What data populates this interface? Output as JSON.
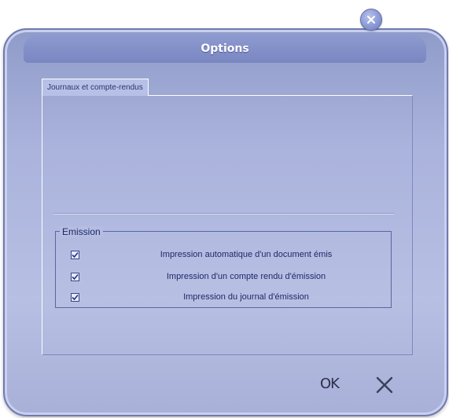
{
  "dialog": {
    "title": "Options"
  },
  "tab": {
    "label": "Journaux et compte-rendus"
  },
  "emission": {
    "group_label": "Emission",
    "items": [
      {
        "label": "Impression automatique d'un document émis",
        "checked": true
      },
      {
        "label": "Impression  d'un compte rendu d'émission",
        "checked": true
      },
      {
        "label": "Impression du journal d'émission",
        "checked": true
      }
    ]
  },
  "buttons": {
    "ok_label": "OK",
    "cancel_icon": "x-icon",
    "close_icon": "close-icon"
  },
  "colors": {
    "window": "#aab3dc",
    "titlebar": "#7986c1",
    "text": "#1f2a66"
  }
}
